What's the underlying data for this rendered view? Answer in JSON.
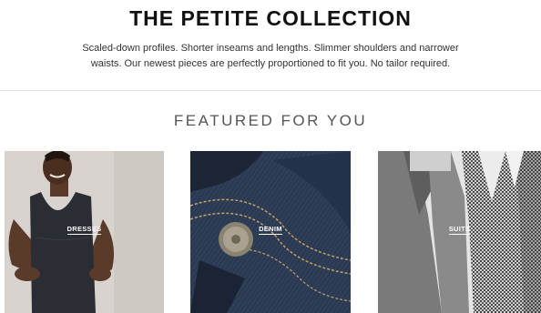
{
  "hero": {
    "title": "THE PETITE COLLECTION",
    "description_line1": "Scaled-down profiles. Shorter inseams and lengths. Slimmer shoulders and narrower",
    "description_line2": "waists. Our newest pieces are perfectly proportioned to fit you. No tailor required."
  },
  "featured": {
    "title": "FEATURED FOR YOU",
    "tiles": [
      {
        "label": "DRESSES"
      },
      {
        "label": "DENIM"
      },
      {
        "label": "SUITS"
      }
    ]
  },
  "colors": {
    "dress_background": "#d8d3ce",
    "dress": "#2a2d33",
    "denim": "#2b3a52",
    "suit_background": "#e4e4e4"
  }
}
